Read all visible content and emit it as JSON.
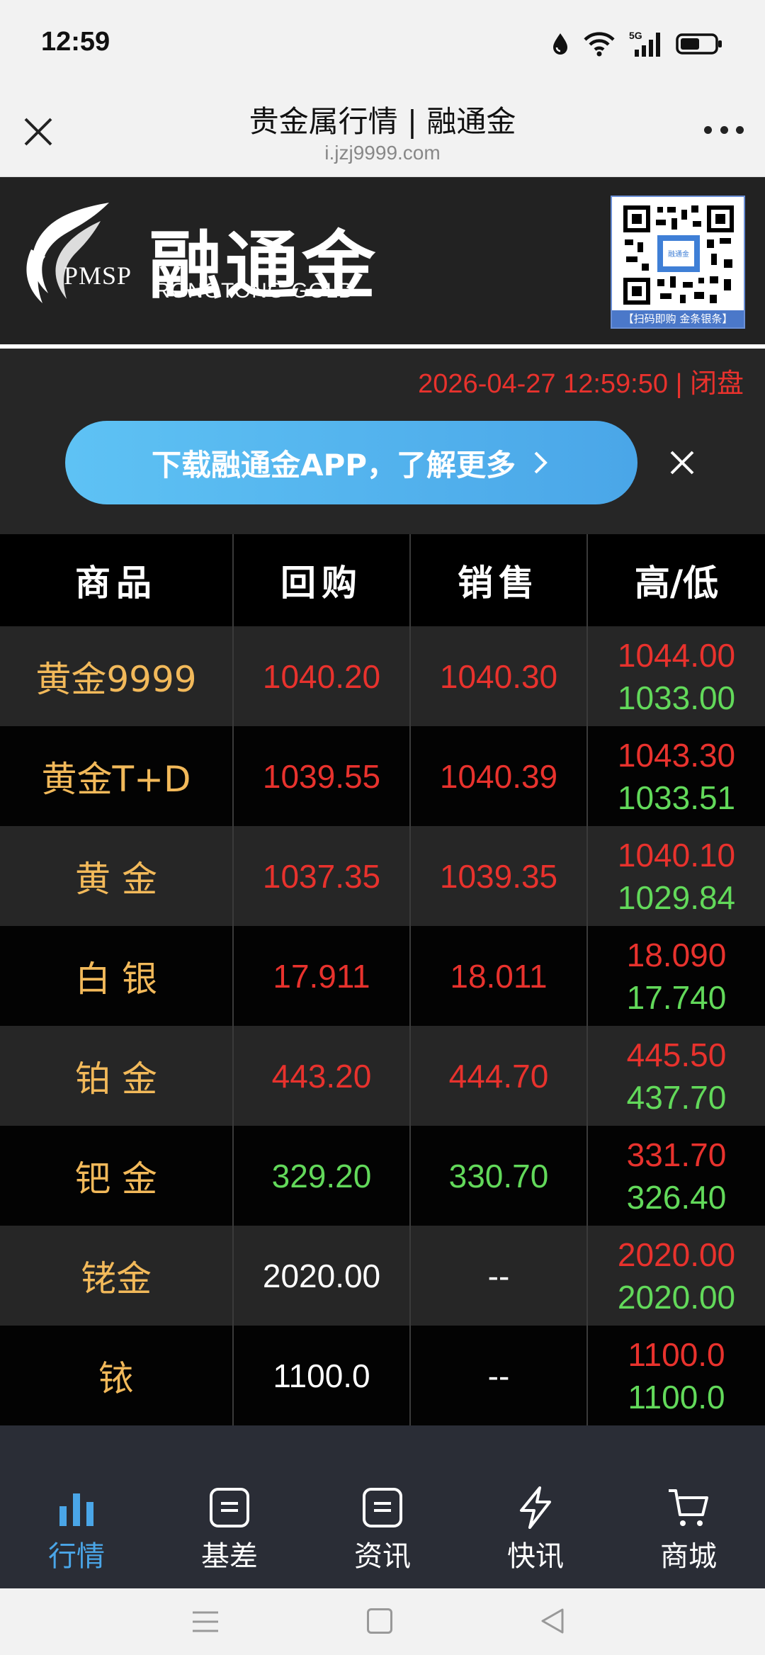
{
  "status": {
    "time": "12:59"
  },
  "browser": {
    "title": "贵金属行情 | 融通金",
    "url": "i.jzj9999.com"
  },
  "brand": {
    "logo_cn": "融通金",
    "logo_en": "RONGTONG  GOLD",
    "logo_pmsp": "PMSP",
    "qr_caption": "【扫码即购 金条银条】"
  },
  "timestamp": "2026-04-27 12:59:50 | 闭盘",
  "banner": {
    "text": "下载融通金APP，了解更多"
  },
  "table": {
    "headers": [
      "商品",
      "回购",
      "销售",
      "高/低"
    ],
    "rows": [
      {
        "name": "黄金9999",
        "buy": "1040.20",
        "sell": "1040.30",
        "high": "1044.00",
        "low": "1033.00",
        "buy_color": "red",
        "sell_color": "red"
      },
      {
        "name": "黄金T+D",
        "buy": "1039.55",
        "sell": "1040.39",
        "high": "1043.30",
        "low": "1033.51",
        "buy_color": "red",
        "sell_color": "red"
      },
      {
        "name": "黄 金",
        "buy": "1037.35",
        "sell": "1039.35",
        "high": "1040.10",
        "low": "1029.84",
        "buy_color": "red",
        "sell_color": "red"
      },
      {
        "name": "白 银",
        "buy": "17.911",
        "sell": "18.011",
        "high": "18.090",
        "low": "17.740",
        "buy_color": "red",
        "sell_color": "red"
      },
      {
        "name": "铂 金",
        "buy": "443.20",
        "sell": "444.70",
        "high": "445.50",
        "low": "437.70",
        "buy_color": "red",
        "sell_color": "red"
      },
      {
        "name": "钯 金",
        "buy": "329.20",
        "sell": "330.70",
        "high": "331.70",
        "low": "326.40",
        "buy_color": "green",
        "sell_color": "green"
      },
      {
        "name": "铑金",
        "buy": "2020.00",
        "sell": "--",
        "high": "2020.00",
        "low": "2020.00",
        "buy_color": "white",
        "sell_color": "white"
      },
      {
        "name": "铱",
        "buy": "1100.0",
        "sell": "--",
        "high": "1100.0",
        "low": "1100.0",
        "buy_color": "white",
        "sell_color": "white"
      }
    ]
  },
  "nav": {
    "items": [
      {
        "label": "行情",
        "icon": "bar-chart-icon",
        "active": true
      },
      {
        "label": "基差",
        "icon": "document-icon",
        "active": false
      },
      {
        "label": "资讯",
        "icon": "document-icon",
        "active": false
      },
      {
        "label": "快讯",
        "icon": "lightning-icon",
        "active": false
      },
      {
        "label": "商城",
        "icon": "cart-icon",
        "active": false
      }
    ]
  },
  "colors": {
    "red": "#e8322d",
    "green": "#62d95a",
    "gold": "#f2b95a",
    "accent": "#4aa6e8"
  }
}
